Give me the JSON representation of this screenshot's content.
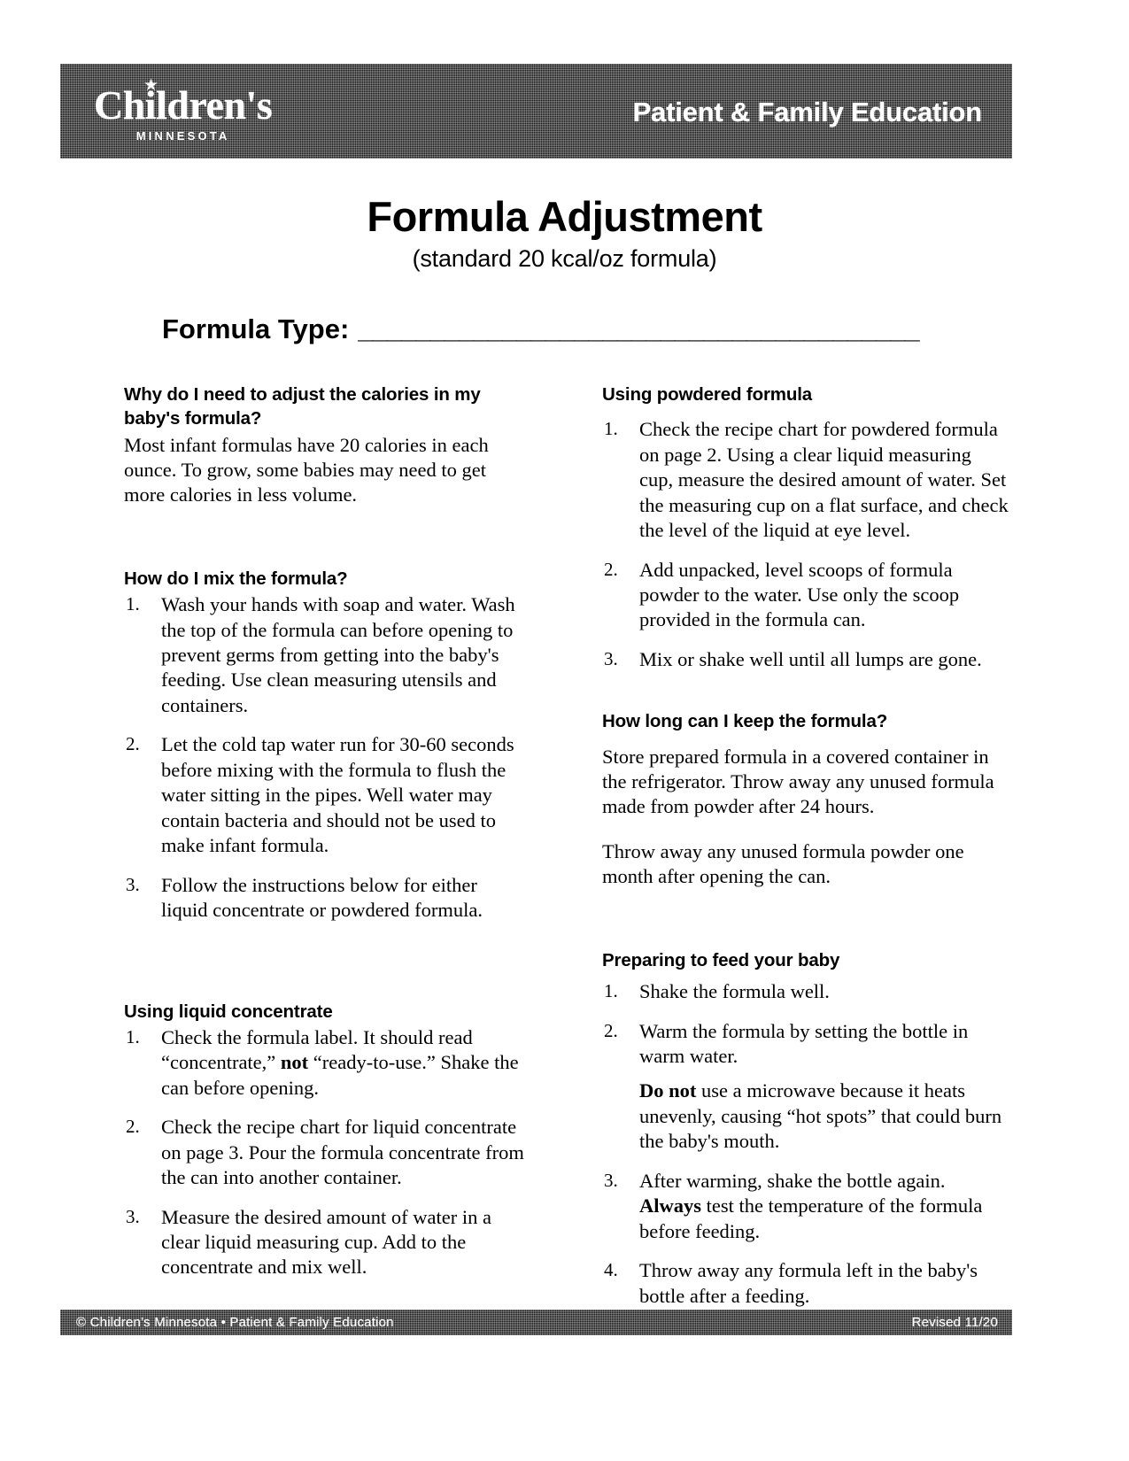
{
  "header": {
    "brand_name": "Children's",
    "brand_star": "★",
    "brand_state": "MINNESOTA",
    "tagline": "Patient & Family Education",
    "bar_color": "#141414",
    "text_color": "#ffffff"
  },
  "title": {
    "main": "Formula Adjustment",
    "subtitle": "(standard 20 kcal/oz formula)"
  },
  "formula_type": {
    "label": "Formula Type:",
    "blank_line": "_______________________________________"
  },
  "left_column": {
    "sections": [
      {
        "heading": "Why do I need to adjust the calories in my baby's formula?",
        "paragraphs": [
          "Most infant formulas have 20 calories in each ounce. To grow, some babies may need to get more calories in less volume."
        ]
      },
      {
        "heading": "How do I mix the formula?",
        "items": [
          {
            "number": "1.",
            "text": "Wash your hands with soap and water. Wash the top of the formula can before opening to prevent germs from getting into the baby's feeding. Use clean measuring utensils and containers."
          },
          {
            "number": "2.",
            "text": "Let the cold tap water run for 30-60 seconds before mixing with the formula to flush the water sitting in the pipes. Well water may contain bacteria and should not be used to make infant formula."
          },
          {
            "number": "3.",
            "text": "Follow the instructions below for either liquid concentrate or powdered formula."
          }
        ]
      },
      {
        "heading": "Using liquid concentrate",
        "items": [
          {
            "number": "1.",
            "text_before": "Check the formula label. It should read “concentrate,” ",
            "bold": "not",
            "text_after": " “ready-to-use.” Shake the can before opening."
          },
          {
            "number": "2.",
            "text": "Check the recipe chart for liquid concentrate on page 3. Pour the formula concentrate from the can into another container."
          },
          {
            "number": "3.",
            "text": "Measure the desired amount of water in a clear liquid measuring cup. Add to the concentrate and mix well."
          }
        ]
      }
    ]
  },
  "right_column": {
    "sections": [
      {
        "heading": "Using powdered formula",
        "items": [
          {
            "number": "1.",
            "text": "Check the recipe chart for powdered formula on page 2. Using a clear liquid measuring cup, measure the desired amount of water. Set the measuring cup on a flat surface, and check the level of the liquid at eye level."
          },
          {
            "number": "2.",
            "text": "Add unpacked, level scoops of formula powder to the water. Use only the scoop provided in the formula can."
          },
          {
            "number": "3.",
            "text": "Mix or shake well until all lumps are gone."
          }
        ]
      },
      {
        "heading": "How long can I keep the formula?",
        "paragraphs": [
          "Store prepared formula in a covered container in the refrigerator. Throw away any unused formula made from powder after 24 hours.",
          "Throw away any unused formula powder one month after opening the can."
        ]
      },
      {
        "heading": "Preparing to feed your baby",
        "items": [
          {
            "number": "1.",
            "text": "Shake the formula well."
          },
          {
            "number": "2.",
            "text": "Warm the formula by setting the bottle in warm water.",
            "sub_bold": "Do not",
            "sub_text": " use a microwave because it heats unevenly, causing “hot spots” that could burn the baby's mouth."
          },
          {
            "number": "3.",
            "text_bold_lead": "",
            "text_before": "After warming, shake the bottle again. ",
            "bold": "Always",
            "text_after": " test the temperature of the formula before feeding."
          },
          {
            "number": "4.",
            "text": "Throw away any formula left in the baby's bottle after a feeding."
          }
        ]
      }
    ]
  },
  "footer": {
    "left": "© Children's Minnesota • Patient & Family Education",
    "right": "Revised 11/20"
  }
}
